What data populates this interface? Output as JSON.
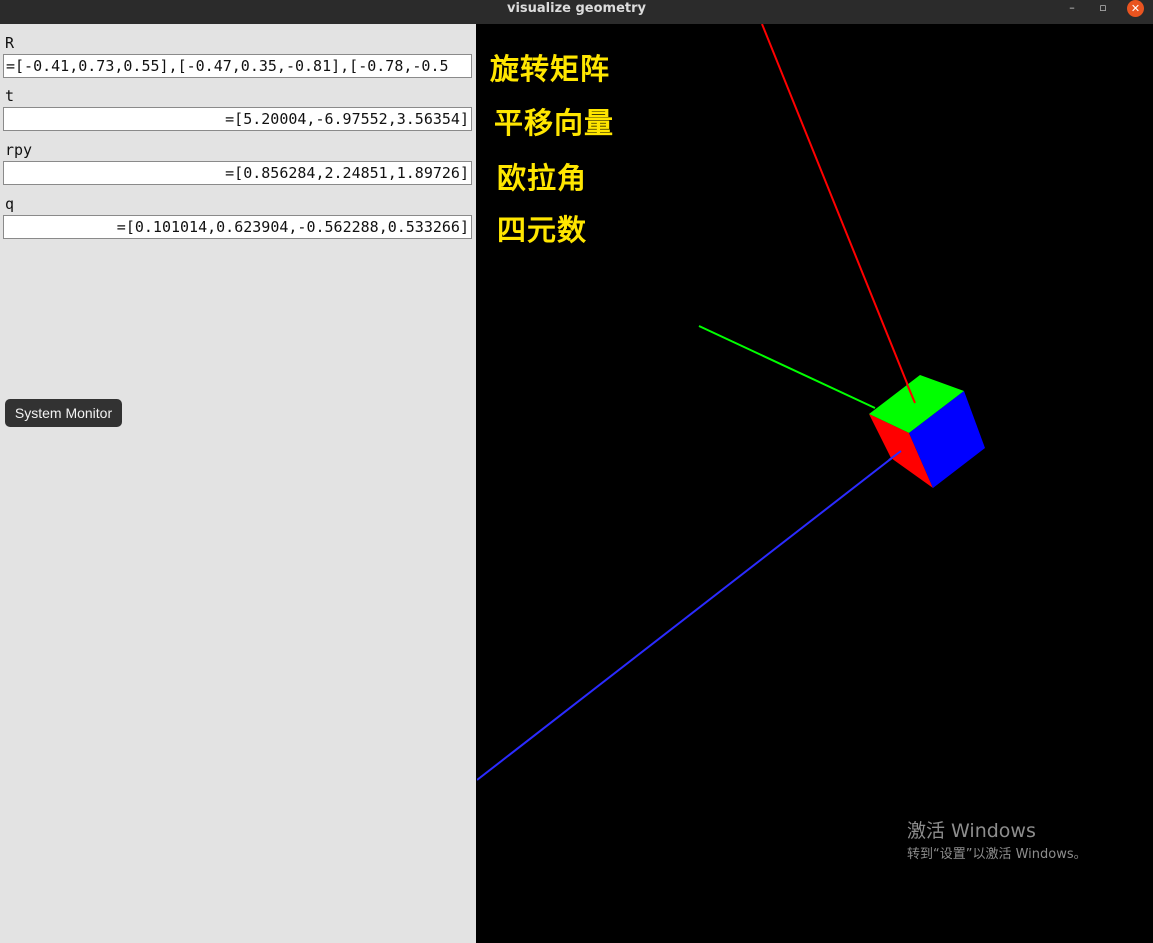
{
  "window": {
    "title": "visualize geometry",
    "controls": {
      "minimize": "–",
      "maximize": "▫",
      "close": "✕"
    }
  },
  "panel": {
    "fields": [
      {
        "label": "R",
        "value": "=[-0.41,0.73,0.55],[-0.47,0.35,-0.81],[-0.78,-0.5"
      },
      {
        "label": "t",
        "value": "=[5.20004,-6.97552,3.56354]"
      },
      {
        "label": "rpy",
        "value": "=[0.856284,2.24851,1.89726]"
      },
      {
        "label": "q",
        "value": "=[0.101014,0.623904,-0.562288,0.533266]"
      }
    ],
    "system_monitor_label": "System Monitor"
  },
  "viewport": {
    "annotations": [
      "旋转矩阵",
      "平移向量",
      "欧拉角",
      "四元数"
    ],
    "annotation_color": "#ffe600",
    "axis_colors": {
      "x": "#ff0000",
      "y": "#00ff00",
      "z": "#0000ff"
    },
    "cube_face_colors": {
      "top": "#00ff00",
      "left": "#ff0000",
      "right": "#0000ff"
    },
    "watermark": {
      "line1": "激活 Windows",
      "line2": "转到“设置”以激活 Windows。"
    }
  },
  "colors": {
    "panel_background": "#e3e3e3",
    "viewport_background": "#000000",
    "titlebar_background": "#2b2b2b",
    "close_button": "#e95420"
  }
}
